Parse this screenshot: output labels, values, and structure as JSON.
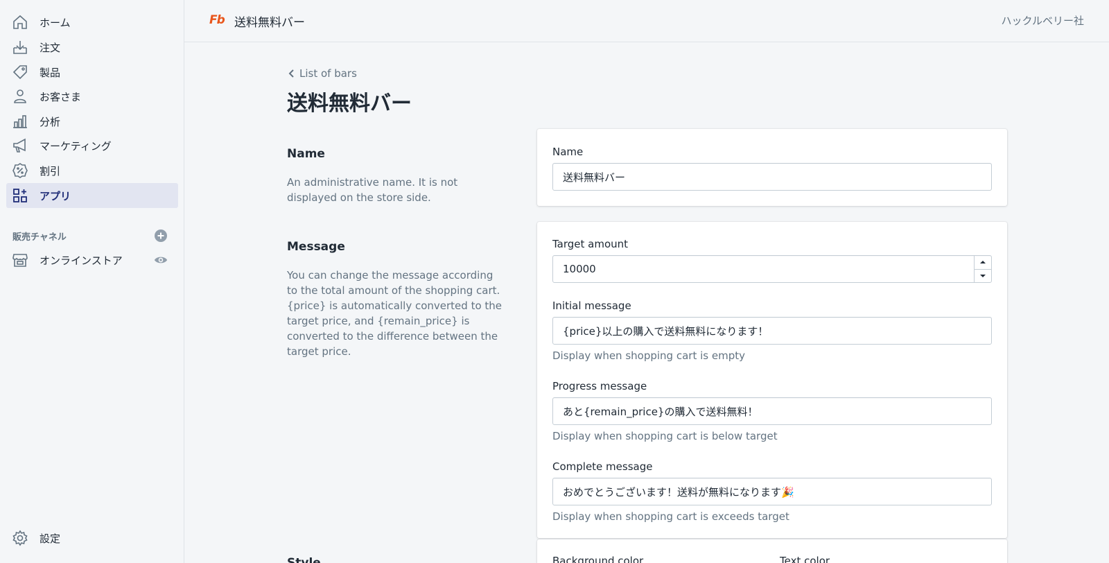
{
  "sidebar": {
    "items": [
      {
        "label": "ホーム",
        "icon": "home-icon"
      },
      {
        "label": "注文",
        "icon": "orders-icon"
      },
      {
        "label": "製品",
        "icon": "products-tag-icon"
      },
      {
        "label": "お客さま",
        "icon": "customer-icon"
      },
      {
        "label": "分析",
        "icon": "analytics-icon"
      },
      {
        "label": "マーケティング",
        "icon": "megaphone-icon"
      },
      {
        "label": "割引",
        "icon": "discount-icon"
      },
      {
        "label": "アプリ",
        "icon": "apps-icon",
        "active": true
      }
    ],
    "channels_title": "販売チャネル",
    "channels": [
      {
        "label": "オンラインストア",
        "icon": "store-icon"
      }
    ],
    "settings_label": "設定"
  },
  "topbar": {
    "logo_text": "Fb",
    "app_title": "送料無料バー",
    "shop_name": "ハックルベリー社"
  },
  "page": {
    "breadcrumb": "List of bars",
    "title": "送料無料バー"
  },
  "sections": {
    "name": {
      "title": "Name",
      "description": "An administrative name. It is not displayed on the store side.",
      "field_label": "Name",
      "field_value": "送料無料バー"
    },
    "message": {
      "title": "Message",
      "description": "You can change the message according to the total amount of the shopping cart. {price} is automatically converted to the target price, and {remain_price} is converted to the difference between the target price.",
      "target_label": "Target amount",
      "target_value": "10000",
      "initial_label": "Initial message",
      "initial_value": "{price}以上の購入で送料無料になります！",
      "initial_help": "Display when shopping cart is empty",
      "progress_label": "Progress message",
      "progress_value": "あと{remain_price}の購入で送料無料！",
      "progress_help": "Display when shopping cart is below target",
      "complete_label": "Complete message",
      "complete_value": "おめでとうございます！送料が無料になります🎉",
      "complete_help": "Display when shopping cart is exceeds target"
    },
    "style": {
      "title": "Style",
      "bg_label": "Background color",
      "text_label": "Text color"
    }
  },
  "colors": {
    "active_nav_bg": "#e2e5f1",
    "active_nav_text": "#202e78",
    "logo_accent": "#e8561c",
    "subdued_text": "#637381"
  }
}
